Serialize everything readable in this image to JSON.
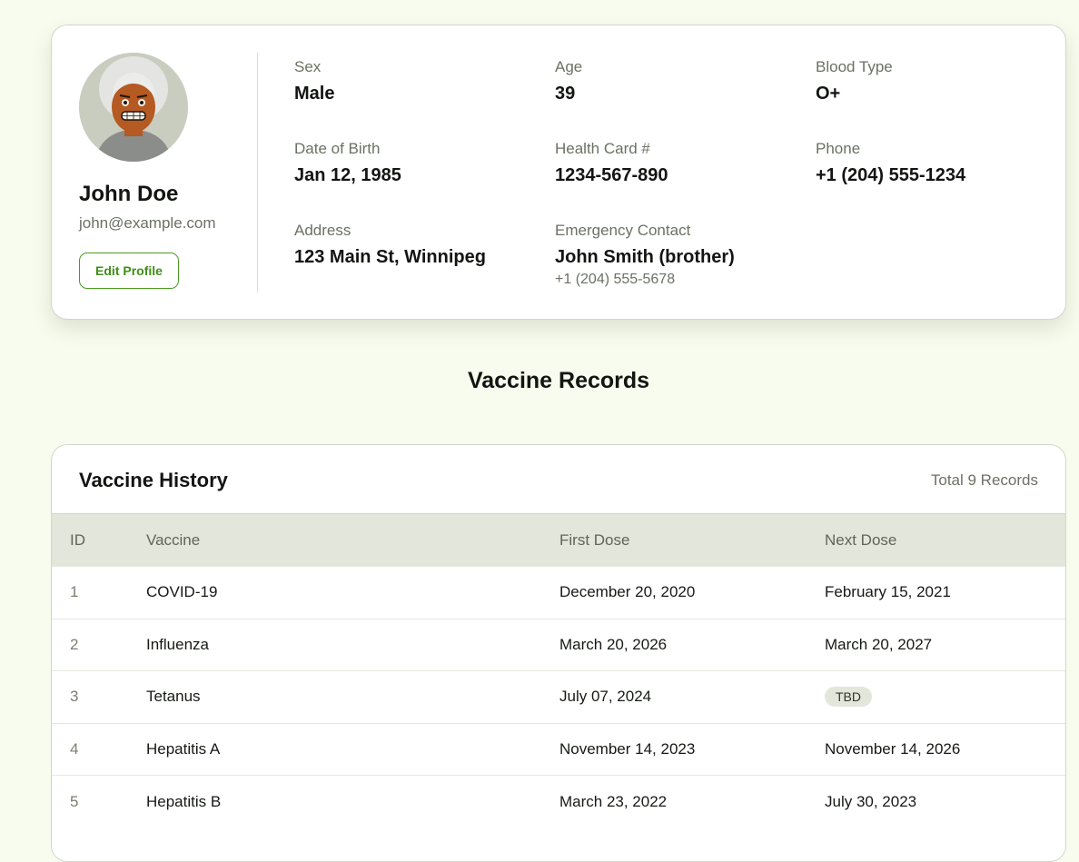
{
  "profile": {
    "name": "John Doe",
    "email": "john@example.com",
    "edit_label": "Edit Profile",
    "fields": [
      {
        "label": "Sex",
        "value": "Male"
      },
      {
        "label": "Age",
        "value": "39"
      },
      {
        "label": "Blood Type",
        "value": "O+"
      },
      {
        "label": "Date of Birth",
        "value": "Jan 12, 1985"
      },
      {
        "label": "Health Card #",
        "value": "1234-567-890"
      },
      {
        "label": "Phone",
        "value": "+1 (204) 555-1234"
      },
      {
        "label": "Address",
        "value": "123 Main St, Winnipeg"
      },
      {
        "label": "Emergency Contact",
        "value": "John Smith (brother)",
        "sub": "+1 (204) 555-5678"
      }
    ]
  },
  "section_title": "Vaccine Records",
  "history": {
    "title": "Vaccine History",
    "total": "Total 9 Records",
    "columns": [
      "ID",
      "Vaccine",
      "First Dose",
      "Next Dose"
    ],
    "rows": [
      {
        "id": "1",
        "vaccine": "COVID-19",
        "first": "December 20, 2020",
        "next": "February 15, 2021"
      },
      {
        "id": "2",
        "vaccine": "Influenza",
        "first": "March 20, 2026",
        "next": "March 20, 2027"
      },
      {
        "id": "3",
        "vaccine": "Tetanus",
        "first": "July 07, 2024",
        "next": "TBD"
      },
      {
        "id": "4",
        "vaccine": "Hepatitis A",
        "first": "November 14, 2023",
        "next": "November 14, 2026"
      },
      {
        "id": "5",
        "vaccine": "Hepatitis B",
        "first": "March 23, 2022",
        "next": "July 30, 2023"
      }
    ]
  },
  "colors": {
    "page_bg": "#f8fcee",
    "accent_green": "#3f8f16",
    "table_header_bg": "#e3e6da"
  },
  "icons": {
    "avatar": "user-avatar-illustration"
  }
}
